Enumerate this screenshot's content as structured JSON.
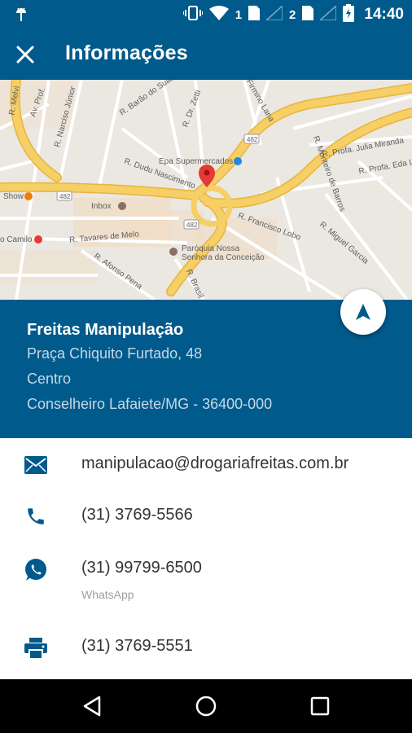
{
  "status_bar": {
    "time": "14:40",
    "sim1": "1",
    "sim2": "2",
    "icons": [
      "android-icon",
      "vibrate-icon",
      "wifi-icon",
      "sim-signal-icon",
      "battery-charging-icon"
    ]
  },
  "app_bar": {
    "title": "Informações",
    "close_icon": "close-icon"
  },
  "map": {
    "labels": {
      "l1": "R. Barão do Suassuí",
      "l2": "Av. Prof.",
      "l3": "R. Narciso Júnior",
      "l4": "R. Dr. Zetti",
      "l5": "Firmino Lana",
      "l6": "R. Profa. Julia Miranda",
      "l7": "R. Profa. Eda Lúcia",
      "l8": "Epa Supermercados",
      "l9": "R. Dudu Nascimento",
      "l10": "R. Monteiro de Barros",
      "l11": "Show",
      "l12": "Inbox",
      "l13": "R. Francisco Lobo",
      "l14": "o Camilo",
      "l15": "R. Tavares de Melo",
      "l16": "Paróquia Nossa",
      "l17": "Senhora da Conceição",
      "l18": "R. Miguel Garcia",
      "l19": "R. Afonso Pena",
      "l20": "R. Brasil",
      "l21": "R. Melvi",
      "road1": "482",
      "road2": "482",
      "road3": "482"
    }
  },
  "store": {
    "name": "Freitas Manipulação",
    "street": "Praça Chiquito Furtado, 48",
    "district": "Centro",
    "city": "Conselheiro Lafaiete/MG - 36400-000"
  },
  "contacts": {
    "email": "manipulacao@drogariafreitas.com.br",
    "phone": "(31) 3769-5566",
    "whatsapp": "(31) 99799-6500",
    "whatsapp_label": "WhatsApp",
    "fax": "(31) 3769-5551"
  },
  "colors": {
    "primary": "#005a8c",
    "map_bg": "#ebe7e1",
    "road_major": "#f6cf65",
    "road_minor": "#ffffff",
    "pin": "#e53935"
  }
}
